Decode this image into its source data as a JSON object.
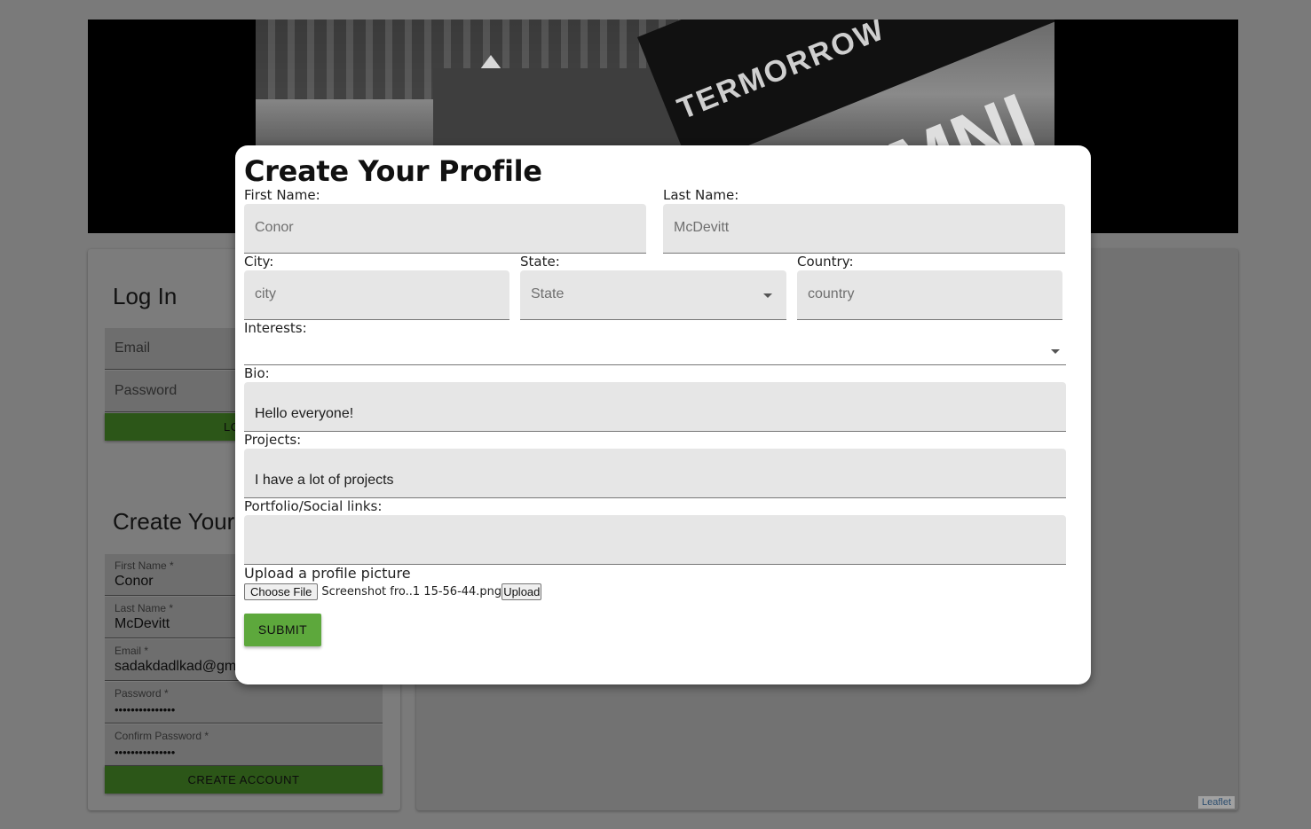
{
  "banner": {
    "tagline": "TERMORROW",
    "word": "UMNI"
  },
  "login": {
    "title": "Log In",
    "email_placeholder": "Email",
    "password_placeholder": "Password",
    "button_label": "LO"
  },
  "create_account": {
    "title": "Create Your",
    "first_name_label": "First Name",
    "first_name_value": "Conor",
    "last_name_label": "Last Name",
    "last_name_value": "McDevitt",
    "email_label": "Email",
    "email_value": "sadakdadlkad@gm",
    "password_label": "Password",
    "password_value": "•••••••••••••••",
    "confirm_label": "Confirm Password",
    "confirm_value": "•••••••••••••••",
    "required_mark": "*",
    "button_label": "CREATE ACCOUNT"
  },
  "map": {
    "attribution": "Leaflet"
  },
  "profile_modal": {
    "title": "Create Your Profile",
    "first_name": {
      "label": "First Name:",
      "placeholder": "Conor"
    },
    "last_name": {
      "label": "Last Name:",
      "placeholder": "McDevitt"
    },
    "city": {
      "label": "City:",
      "placeholder": "city"
    },
    "state": {
      "label": "State:",
      "selected": "State"
    },
    "country": {
      "label": "Country:",
      "placeholder": "country"
    },
    "interests": {
      "label": "Interests:"
    },
    "bio": {
      "label": "Bio:",
      "value": "Hello everyone!"
    },
    "projects": {
      "label": "Projects:",
      "value": "I have a lot of projects"
    },
    "portfolio": {
      "label": "Portfolio/Social links:",
      "value": ""
    },
    "upload": {
      "label": "Upload a profile picture",
      "choose_label": "Choose File",
      "file_name": "Screenshot fro..1 15-56-44.png",
      "upload_label": "Upload"
    },
    "submit_label": "SUBMIT"
  }
}
